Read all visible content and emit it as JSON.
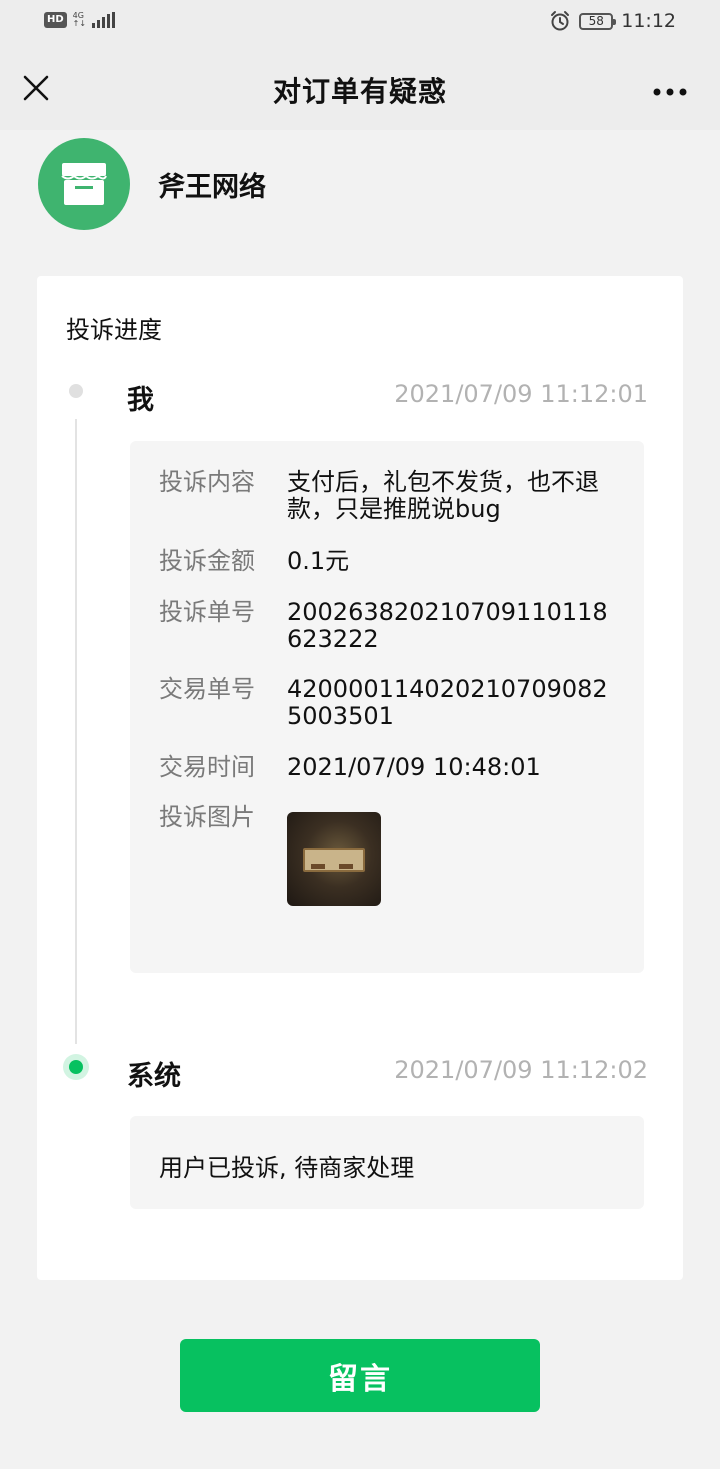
{
  "status_bar": {
    "hd": "HD",
    "network_top": "4G",
    "network_bottom": "↑↓",
    "battery": "58",
    "time": "11:12"
  },
  "nav": {
    "title": "对订单有疑惑",
    "close_icon": "close-icon",
    "more_icon": "more-icon"
  },
  "merchant": {
    "name": "斧王网络",
    "icon": "store-icon",
    "avatar_color": "#3fb46f"
  },
  "progress": {
    "title": "投诉进度",
    "entries": [
      {
        "who": "我",
        "time": "2021/07/09 11:12:01",
        "details": [
          {
            "label": "投诉内容",
            "value": "支付后，礼包不发货，也不退款，只是推脱说bug"
          },
          {
            "label": "投诉金额",
            "value": "0.1元"
          },
          {
            "label": "投诉单号",
            "value": "200263820210709110118623222"
          },
          {
            "label": "交易单号",
            "value": "420000114020210709082500350​1"
          },
          {
            "label": "交易时间",
            "value": "2021/07/09 10:48:01"
          },
          {
            "label": "投诉图片",
            "value": ""
          }
        ]
      },
      {
        "who": "系统",
        "time": "2021/07/09 11:12:02",
        "message": "用户已投诉, 待商家处理"
      }
    ]
  },
  "action": {
    "button_label": "留言",
    "color": "#07c160"
  }
}
